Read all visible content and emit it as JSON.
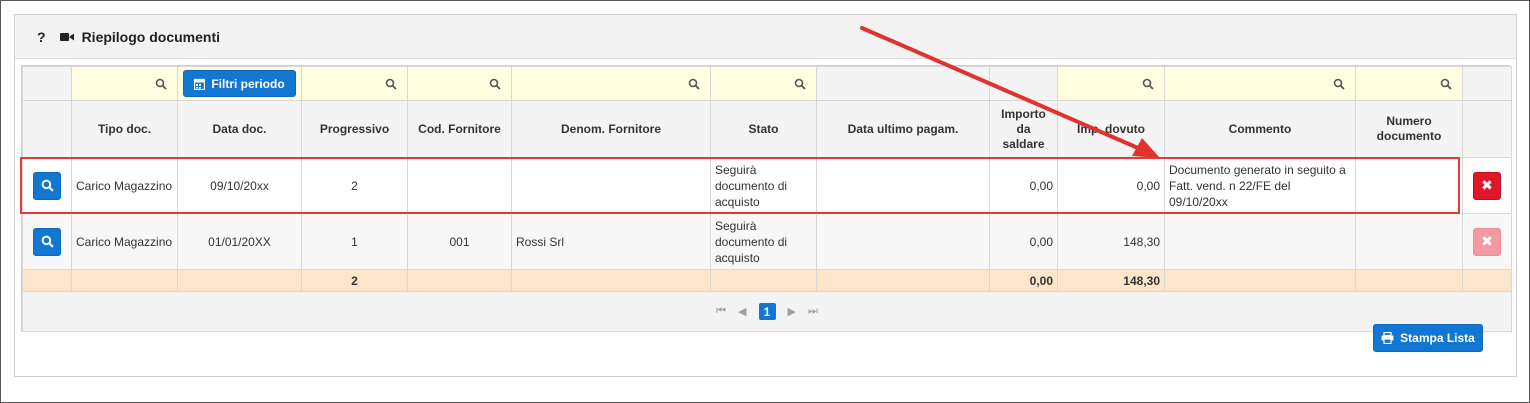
{
  "header": {
    "help": "?",
    "title": "Riepilogo documenti"
  },
  "filters": {
    "filtri_periodo_label": "Filtri periodo"
  },
  "columns": [
    "Tipo doc.",
    "Data doc.",
    "Progressivo",
    "Cod. Fornitore",
    "Denom. Fornitore",
    "Stato",
    "Data ultimo pagam.",
    "Importo da saldare",
    "Imp. dovuto",
    "Commento",
    "Numero documento"
  ],
  "rows": [
    {
      "tipo_doc": "Carico Magazzino",
      "data_doc": "09/10/20xx",
      "progressivo": "2",
      "cod_fornitore": "",
      "denom_fornitore": "",
      "stato": "Seguirà documento di acquisto",
      "data_ultimo_pagam": "",
      "importo_da_saldare": "0,00",
      "imp_dovuto": "0,00",
      "commento": "Documento generato in seguito a Fatt. vend. n 22/FE del 09/10/20xx",
      "numero_documento": ""
    },
    {
      "tipo_doc": "Carico Magazzino",
      "data_doc": "01/01/20XX",
      "progressivo": "1",
      "cod_fornitore": "001",
      "denom_fornitore": "Rossi Srl",
      "stato": "Seguirà documento di acquisto",
      "data_ultimo_pagam": "",
      "importo_da_saldare": "0,00",
      "imp_dovuto": "148,30",
      "commento": "",
      "numero_documento": ""
    }
  ],
  "totals": {
    "progressivo": "2",
    "importo_da_saldare": "0,00",
    "imp_dovuto": "148,30"
  },
  "pager": {
    "current_page": "1"
  },
  "footer": {
    "stampa_label": "Stampa Lista"
  },
  "colors": {
    "accent": "#1276d3",
    "delete": "#e0162b",
    "total_row": "#fde5cc",
    "filter_row": "#fffee0",
    "highlight": "#e23a3a"
  }
}
